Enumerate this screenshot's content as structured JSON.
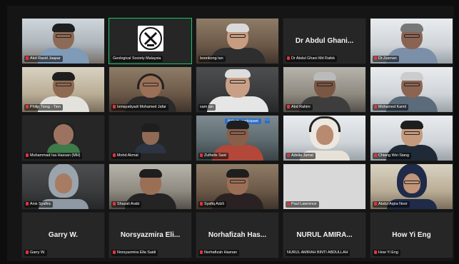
{
  "participants": [
    {
      "name": "Abd Rasid Jaapar",
      "kind": "video"
    },
    {
      "name": "Geological Society Malaysia",
      "kind": "logo"
    },
    {
      "name": "boonkong tan",
      "kind": "video"
    },
    {
      "name": "Dr Abdul Ghani Md Rafek",
      "kind": "avatar",
      "display": "Dr Abdul Ghani..."
    },
    {
      "name": "Dr.Jusman",
      "kind": "video"
    },
    {
      "name": "Philip Tiong - Tien",
      "kind": "video"
    },
    {
      "name": "Ismayatiyadi Mohamed Jafar",
      "kind": "video"
    },
    {
      "name": "sam tan",
      "kind": "video"
    },
    {
      "name": "Abd Rahim",
      "kind": "video"
    },
    {
      "name": "Mohamed Kamil",
      "kind": "video"
    },
    {
      "name": "Muhammad Isa Hassan (MH)",
      "kind": "video"
    },
    {
      "name": "Mohd Akmal",
      "kind": "video"
    },
    {
      "name": "Zulhelis Said",
      "kind": "video",
      "chip": "Hide in...participant"
    },
    {
      "name": "Adelia Jamal",
      "kind": "video"
    },
    {
      "name": "Chiang Wei Siang",
      "kind": "video"
    },
    {
      "name": "Anis Syafira",
      "kind": "video"
    },
    {
      "name": "Shazali Arabi",
      "kind": "video"
    },
    {
      "name": "Syafiq Adzli",
      "kind": "video"
    },
    {
      "name": "Paul Lawrence",
      "kind": "video"
    },
    {
      "name": "Abdul Aqira Noor",
      "kind": "video"
    },
    {
      "name": "Garry W.",
      "kind": "avatar",
      "display": "Garry W."
    },
    {
      "name": "Norsyazmira Ella Saidi",
      "kind": "avatar",
      "display": "Norsyazmira Eli..."
    },
    {
      "name": "Norhafizah Hasnan",
      "kind": "avatar",
      "display": "Norhafizah Has..."
    },
    {
      "name": "NURUL AMIRAH BINTI ABDULLAH",
      "kind": "avatar",
      "display": "NURUL AMIRA..."
    },
    {
      "name": "How Yi Eng",
      "kind": "avatar",
      "display": "How Yi Eng"
    }
  ],
  "colors": {
    "active_speaker": "#1ec56b",
    "mic_muted": "#e0343a",
    "background": "#151515"
  }
}
